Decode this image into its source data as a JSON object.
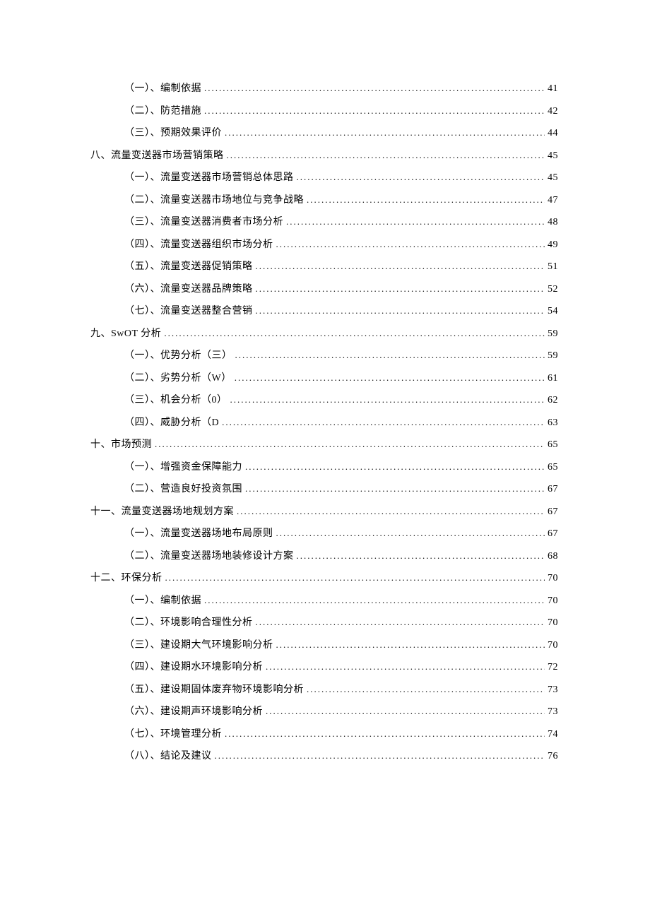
{
  "toc": [
    {
      "level": 2,
      "label": "（一）、编制依据",
      "page": "41"
    },
    {
      "level": 2,
      "label": "（二）、防范措施",
      "page": "42"
    },
    {
      "level": 2,
      "label": "（三）、预期效果评价",
      "page": "44"
    },
    {
      "level": 1,
      "label": "八、流量变送器市场营销策略 ",
      "page": "45"
    },
    {
      "level": 2,
      "label": "（一）、流量变送器市场营销总体思路",
      "page": "45"
    },
    {
      "level": 2,
      "label": "（二）、流量变送器市场地位与竞争战略",
      "page": "47"
    },
    {
      "level": 2,
      "label": "（三）、流量变送器消费者市场分析",
      "page": "48"
    },
    {
      "level": 2,
      "label": "（四）、流量变送器组织市场分析",
      "page": "49"
    },
    {
      "level": 2,
      "label": "（五）、流量变送器促销策略",
      "page": "51"
    },
    {
      "level": 2,
      "label": "（六）、流量变送器品牌策略",
      "page": "52"
    },
    {
      "level": 2,
      "label": "（七）、流量变送器整合营销",
      "page": "54"
    },
    {
      "level": 1,
      "label": "九、SwOT 分析 ",
      "page": "59"
    },
    {
      "level": 2,
      "label": "（一）、优势分析（三） ",
      "page": "59"
    },
    {
      "level": 2,
      "label": "（二）、劣势分析（W） ",
      "page": "61"
    },
    {
      "level": 2,
      "label": "（三）、机会分析（0） ",
      "page": "62"
    },
    {
      "level": 2,
      "label": "（四）、威胁分析（D ",
      "page": "63"
    },
    {
      "level": 1,
      "label": "十、市场预测 ",
      "page": "65"
    },
    {
      "level": 2,
      "label": "（一）、增强资金保障能力",
      "page": "65"
    },
    {
      "level": 2,
      "label": "（二）、营造良好投资氛围",
      "page": "67"
    },
    {
      "level": 1,
      "label": "十一、流量变送器场地规划方案 ",
      "page": "67"
    },
    {
      "level": 2,
      "label": "（一）、流量变送器场地布局原则",
      "page": "67"
    },
    {
      "level": 2,
      "label": "（二）、流量变送器场地装修设计方案",
      "page": "68"
    },
    {
      "level": 1,
      "label": "十二、环保分析 ",
      "page": "70"
    },
    {
      "level": 2,
      "label": "（一）、编制依据",
      "page": "70"
    },
    {
      "level": 2,
      "label": "（二）、环境影响合理性分析",
      "page": "70"
    },
    {
      "level": 2,
      "label": "（三）、建设期大气环境影响分析",
      "page": "70"
    },
    {
      "level": 2,
      "label": "（四）、建设期水环境影响分析",
      "page": "72"
    },
    {
      "level": 2,
      "label": "（五）、建设期固体废弃物环境影响分析",
      "page": "73"
    },
    {
      "level": 2,
      "label": "（六）、建设期声环境影响分析",
      "page": "73"
    },
    {
      "level": 2,
      "label": "（七）、环境管理分析",
      "page": "74"
    },
    {
      "level": 2,
      "label": "（八）、结论及建议",
      "page": "76"
    }
  ]
}
